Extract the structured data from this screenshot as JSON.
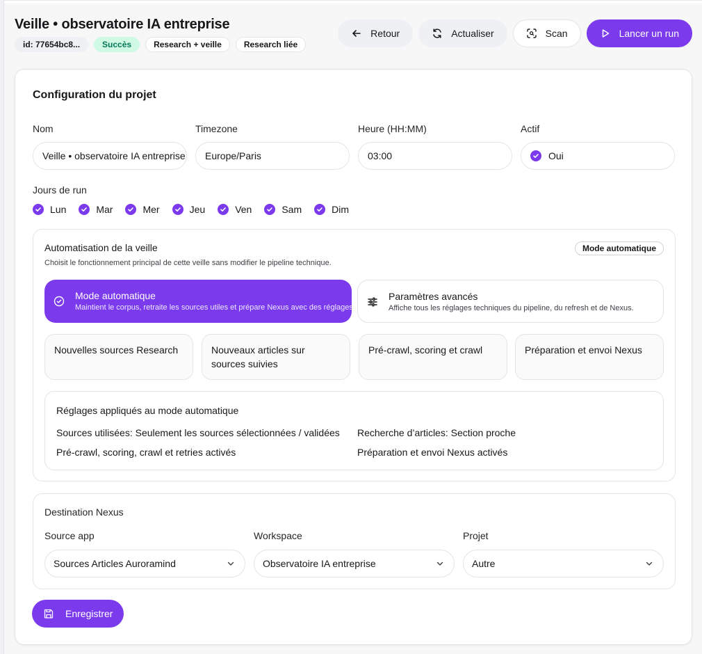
{
  "header": {
    "title": "Veille • observatoire IA entreprise",
    "chips": {
      "id": "id: 77654bc8...",
      "status": "Succès",
      "type": "Research + veille",
      "linked": "Research liée"
    },
    "actions": {
      "back": "Retour",
      "refresh": "Actualiser",
      "scan": "Scan",
      "run": "Lancer un run"
    }
  },
  "config": {
    "title": "Configuration du projet",
    "name": {
      "label": "Nom",
      "value": "Veille • observatoire IA entreprise"
    },
    "timezone": {
      "label": "Timezone",
      "value": "Europe/Paris"
    },
    "hour": {
      "label": "Heure (HH:MM)",
      "value": "03:00"
    },
    "active": {
      "label": "Actif",
      "value": "Oui"
    },
    "days_label": "Jours de run",
    "days": [
      "Lun",
      "Mar",
      "Mer",
      "Jeu",
      "Ven",
      "Sam",
      "Dim"
    ]
  },
  "automation": {
    "title": "Automatisation de la veille",
    "subtitle": "Choisit le fonctionnement principal de cette veille sans modifier le pipeline technique.",
    "badge": "Mode automatique",
    "modes": {
      "auto": {
        "title": "Mode automatique",
        "desc": "Maintient le corpus, retraite les sources utiles et prépare Nexus avec des réglages"
      },
      "advanced": {
        "title": "Paramètres avancés",
        "desc": "Affiche tous les réglages techniques du pipeline, du refresh et de Nexus."
      }
    },
    "steps": [
      "Nouvelles sources Research",
      "Nouveaux articles sur sources suivies",
      "Pré-crawl, scoring et crawl",
      "Préparation et envoi Nexus"
    ],
    "applied": {
      "title": "Réglages appliqués au mode automatique",
      "items": [
        "Sources utilisées: Seulement les sources sélectionnées / validées",
        "Recherche d’articles: Section proche",
        "Pré-crawl, scoring, crawl et retries activés",
        "Préparation et envoi Nexus activés"
      ]
    }
  },
  "nexus": {
    "title": "Destination Nexus",
    "source_app": {
      "label": "Source app",
      "value": "Sources Articles Auroramind"
    },
    "workspace": {
      "label": "Workspace",
      "value": "Observatoire IA entreprise"
    },
    "project": {
      "label": "Projet",
      "value": "Autre"
    }
  },
  "save_label": "Enregistrer",
  "colors": {
    "accent": "#7c3aed",
    "success_bg": "#d1fae5",
    "success_text": "#047857"
  }
}
